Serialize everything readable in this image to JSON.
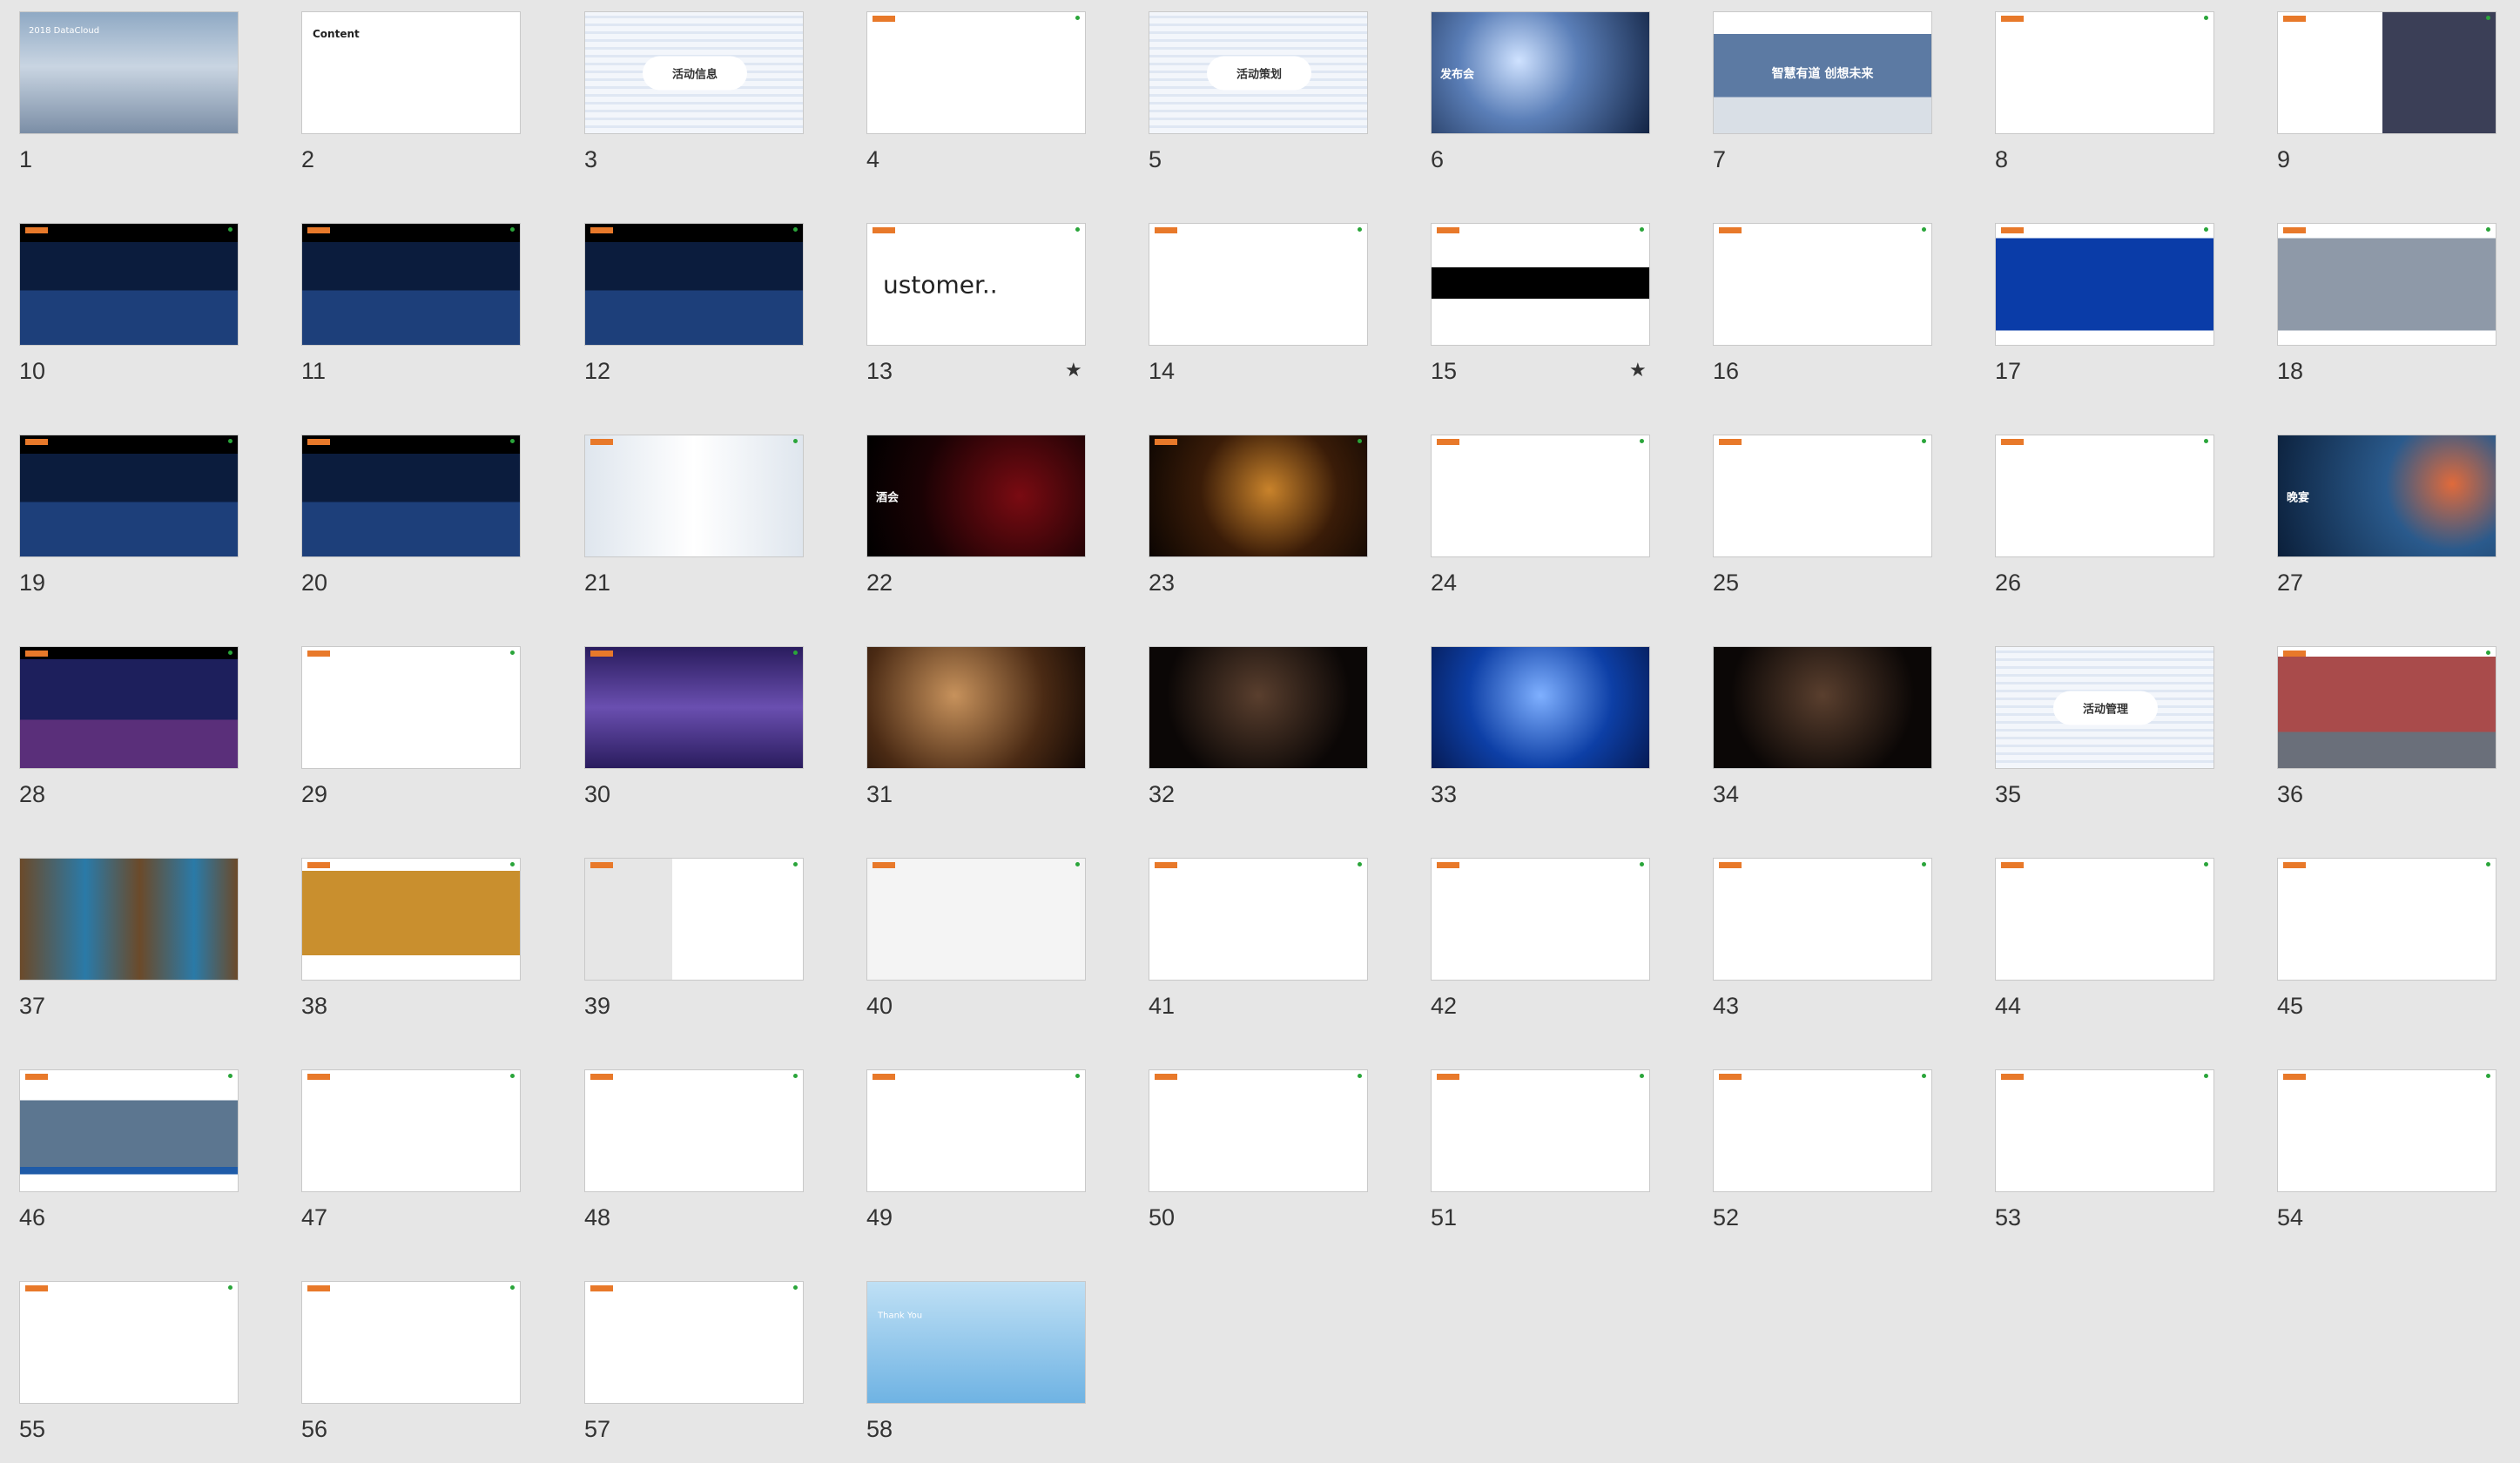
{
  "slides": [
    {
      "n": "1",
      "title": "2018 DataCloud",
      "style": "clouds"
    },
    {
      "n": "2",
      "title": "Content",
      "style": "content"
    },
    {
      "n": "3",
      "title": "活动信息",
      "style": "wordcloud"
    },
    {
      "n": "4",
      "title": "",
      "style": "hotel"
    },
    {
      "n": "5",
      "title": "活动策划",
      "style": "wordcloud"
    },
    {
      "n": "6",
      "title": "发布会",
      "style": "mic"
    },
    {
      "n": "7",
      "title": "智慧有道 创想未来",
      "style": "banner"
    },
    {
      "n": "8",
      "title": "",
      "style": "tablegreen"
    },
    {
      "n": "9",
      "title": "",
      "style": "stage9"
    },
    {
      "n": "10",
      "title": "",
      "style": "stage"
    },
    {
      "n": "11",
      "title": "",
      "style": "stage"
    },
    {
      "n": "12",
      "title": "",
      "style": "stage"
    },
    {
      "n": "13",
      "title": "ustomer..",
      "style": "customer"
    },
    {
      "n": "14",
      "title": "",
      "style": "collage"
    },
    {
      "n": "15",
      "title": "",
      "style": "blackband"
    },
    {
      "n": "16",
      "title": "",
      "style": "collage2"
    },
    {
      "n": "17",
      "title": "",
      "style": "bluestage"
    },
    {
      "n": "18",
      "title": "",
      "style": "photo18"
    },
    {
      "n": "19",
      "title": "",
      "style": "stage"
    },
    {
      "n": "20",
      "title": "",
      "style": "stage"
    },
    {
      "n": "21",
      "title": "",
      "style": "man"
    },
    {
      "n": "22",
      "title": "酒会",
      "style": "wine"
    },
    {
      "n": "23",
      "title": "",
      "style": "wine2"
    },
    {
      "n": "24",
      "title": "",
      "style": "tableorange"
    },
    {
      "n": "25",
      "title": "",
      "style": "bottles"
    },
    {
      "n": "26",
      "title": "",
      "style": "barrel"
    },
    {
      "n": "27",
      "title": "晚宴",
      "style": "bokeh"
    },
    {
      "n": "28",
      "title": "",
      "style": "stage28"
    },
    {
      "n": "29",
      "title": "",
      "style": "tablegreen"
    },
    {
      "n": "30",
      "title": "",
      "style": "purple"
    },
    {
      "n": "31",
      "title": "",
      "style": "toast"
    },
    {
      "n": "32",
      "title": "",
      "style": "dark"
    },
    {
      "n": "33",
      "title": "",
      "style": "singer"
    },
    {
      "n": "34",
      "title": "",
      "style": "dark"
    },
    {
      "n": "35",
      "title": "活动管理",
      "style": "wordcloud"
    },
    {
      "n": "36",
      "title": "",
      "style": "hotel36"
    },
    {
      "n": "37",
      "title": "",
      "style": "lobby"
    },
    {
      "n": "38",
      "title": "",
      "style": "photo38"
    },
    {
      "n": "39",
      "title": "",
      "style": "map"
    },
    {
      "n": "40",
      "title": "",
      "style": "floorplan"
    },
    {
      "n": "41",
      "title": "",
      "style": "datatable"
    },
    {
      "n": "42",
      "title": "",
      "style": "rooms"
    },
    {
      "n": "43",
      "title": "",
      "style": "redlist"
    },
    {
      "n": "44",
      "title": "",
      "style": "collage44"
    },
    {
      "n": "45",
      "title": "",
      "style": "collage45"
    },
    {
      "n": "46",
      "title": "",
      "style": "process"
    },
    {
      "n": "47",
      "title": "",
      "style": "camera"
    },
    {
      "n": "48",
      "title": "",
      "style": "orgchart"
    },
    {
      "n": "49",
      "title": "",
      "style": "woman"
    },
    {
      "n": "50",
      "title": "",
      "style": "text"
    },
    {
      "n": "51",
      "title": "",
      "style": "chips"
    },
    {
      "n": "52",
      "title": "",
      "style": "venn"
    },
    {
      "n": "53",
      "title": "",
      "style": "collage53"
    },
    {
      "n": "54",
      "title": "",
      "style": "collage54"
    },
    {
      "n": "55",
      "title": "",
      "style": "collage55"
    },
    {
      "n": "56",
      "title": "",
      "style": "collage56"
    },
    {
      "n": "57",
      "title": "",
      "style": "collage57"
    },
    {
      "n": "58",
      "title": "Thank You",
      "style": "thanks"
    }
  ],
  "stars": [
    "★",
    "★"
  ],
  "colors": {
    "background": "#e6e6e6",
    "accent": "#e8792a",
    "green": "#2aa53a"
  }
}
